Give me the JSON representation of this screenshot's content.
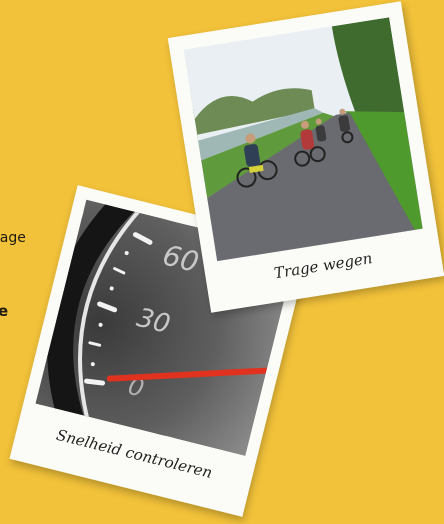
{
  "background_color": "#f2c23a",
  "side_text": {
    "line1": "rage",
    "line2": "e"
  },
  "polaroids": [
    {
      "caption": "Snelheid controleren",
      "photo_subject": "speedometer",
      "gauge_labels": [
        "60",
        "30",
        "0"
      ]
    },
    {
      "caption": "Trage wegen",
      "photo_subject": "cyclists-on-path"
    }
  ]
}
